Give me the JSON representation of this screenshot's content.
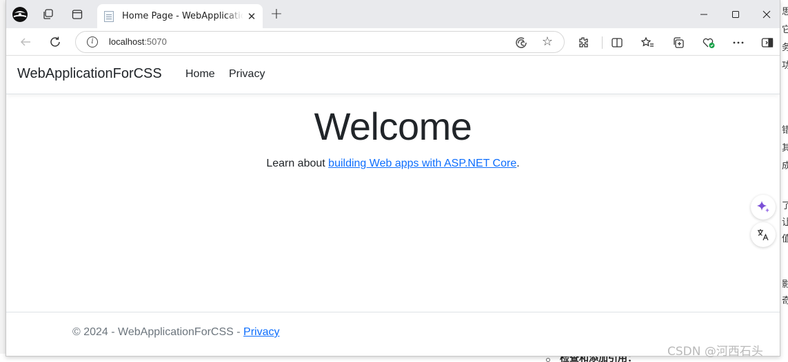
{
  "browser": {
    "tab": {
      "title": "Home Page - WebApplicationForCSS",
      "close": "✕"
    },
    "new_tab": "+",
    "address": {
      "host": "localhost",
      "port": ":5070"
    }
  },
  "site": {
    "brand": "WebApplicationForCSS",
    "nav": [
      {
        "label": "Home"
      },
      {
        "label": "Privacy"
      }
    ],
    "heading": "Welcome",
    "learn_prefix": "Learn about ",
    "learn_link": "building Web apps with ASP.NET Core",
    "learn_suffix": ".",
    "footer_text": "© 2024 - WebApplicationForCSS - ",
    "footer_link": "Privacy"
  },
  "background": {
    "right_chars": [
      "思",
      "它",
      "务",
      "功",
      "错",
      "其",
      "成",
      "了",
      "让",
      "值",
      "影",
      "奇"
    ],
    "bottom_text": "检查和添加引用："
  },
  "watermark": "CSDN @河西石头",
  "colors": {
    "link": "#0d6efd",
    "text": "#212529",
    "muted": "#6c757d"
  }
}
